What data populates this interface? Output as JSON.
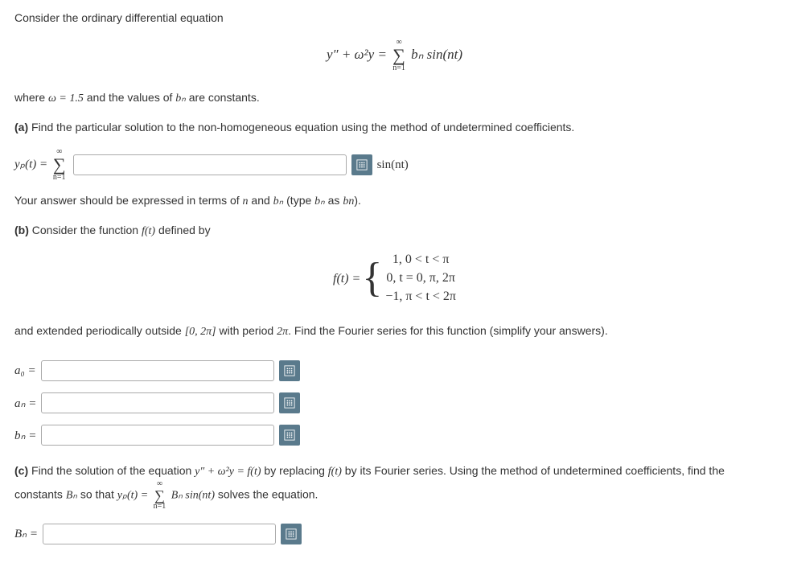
{
  "intro": "Consider the ordinary differential equation",
  "eq1_lhs": "y″ + ω²y = ",
  "eq1_sum_top": "∞",
  "eq1_sum_bot": "n=1",
  "eq1_rhs": "bₙ sin(nt)",
  "where_pre": "where ",
  "where_math": "ω = 1.5",
  "where_mid": " and the values of ",
  "where_bn": "bₙ",
  "where_post": " are constants.",
  "part_a_label": "(a)",
  "part_a_text": " Find the particular solution to the non-homogeneous equation using the method of undetermined coefficients.",
  "yp_label": "yₚ(t) = ",
  "yp_sum_top": "∞",
  "yp_sum_bot": "n=1",
  "yp_after": " sin(nt)",
  "note_a_pre": "Your answer should be expressed in terms of ",
  "note_a_n": "n",
  "note_a_and": " and ",
  "note_a_bn": "bₙ",
  "note_a_mid": " (type ",
  "note_a_bn2": "bₙ",
  "note_a_as": " as ",
  "note_a_bn3": "bn",
  "note_a_end": ").",
  "part_b_label": "(b)",
  "part_b_text": " Consider the function ",
  "part_b_ft": "f(t)",
  "part_b_text2": " defined by",
  "piecewise_lhs": "f(t) = ",
  "case1": "1,    0 < t < π",
  "case2": "0,    t = 0, π, 2π",
  "case3": "−1,   π < t < 2π",
  "extend_pre": "and extended periodically outside ",
  "extend_interval": "[0, 2π]",
  "extend_mid": " with period ",
  "extend_period": "2π",
  "extend_post": ". Find the Fourier series for this function (simplify your answers).",
  "a0_label": "a₀ = ",
  "an_label": "aₙ = ",
  "bn_label": "bₙ = ",
  "part_c_label": "(c)",
  "part_c_text1": " Find the solution of the equation ",
  "part_c_eq": "y″ + ω²y = f(t)",
  "part_c_text2": " by replacing ",
  "part_c_ft": "f(t)",
  "part_c_text3": " by its Fourier series. Using the method of undetermined coefficients, find the constants ",
  "part_c_Bn": "Bₙ",
  "part_c_text4": " so that ",
  "part_c_yp": "yₚ(t) = ",
  "part_c_sum_top": "∞",
  "part_c_sum_bot": "n=1",
  "part_c_rhs": " Bₙ sin(nt)",
  "part_c_text5": " solves the equation.",
  "Bn_label": "Bₙ = "
}
